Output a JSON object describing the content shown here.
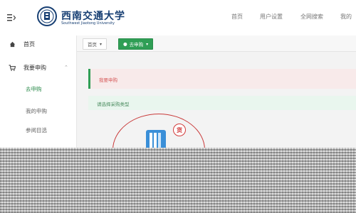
{
  "header": {
    "logo_cn": "西南交通大学",
    "logo_en": "Southwest Jiaotong University",
    "nav": [
      "首页",
      "用户设置",
      "全网搜索",
      "我的"
    ]
  },
  "sidebar": {
    "home_label": "首页",
    "purchase_label": "我要申购",
    "sub_items": [
      "去申购",
      "我的申购",
      "参阅目选"
    ]
  },
  "tabs": {
    "home": "首页",
    "active": "去申购"
  },
  "main": {
    "alert": "我要申购",
    "info": "请选择采购类型",
    "badge": "货"
  },
  "colors": {
    "brand_blue": "#173f73",
    "accent_green": "#2f9e55",
    "alert_red": "#d65a5a",
    "circle_red": "#c93a3a"
  },
  "icons": {
    "menu_toggle": "menu-toggle-icon",
    "home": "home-icon",
    "cart": "cart-icon",
    "book": "book-icon",
    "badge": "goods-badge-icon"
  }
}
